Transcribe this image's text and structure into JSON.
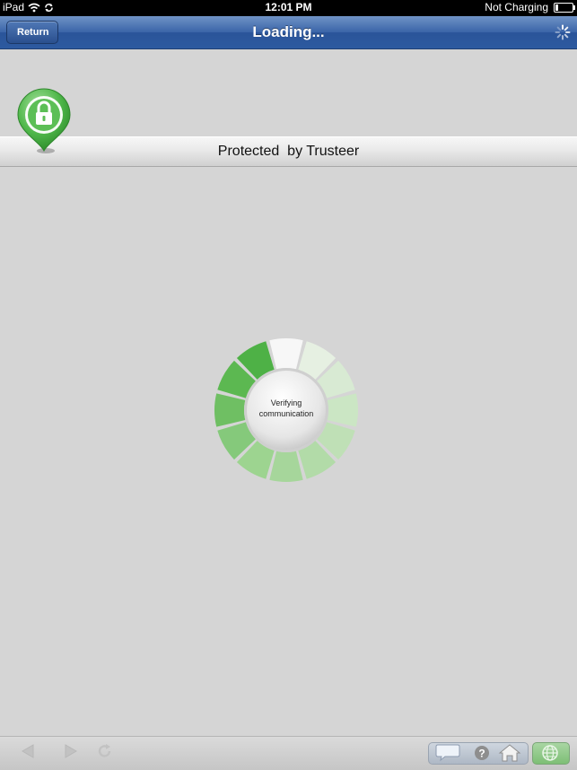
{
  "status_bar": {
    "device": "iPad",
    "time": "12:01 PM",
    "charge_status": "Not Charging"
  },
  "nav": {
    "back_label": "Return",
    "title": "Loading..."
  },
  "banner": {
    "text": "Protected  by Trusteer"
  },
  "progress": {
    "label_line1": "Verifying",
    "label_line2": "communication"
  },
  "colors": {
    "nav_blue": "#2d5aa0",
    "accent_green": "#4db34d",
    "background": "#d5d5d5"
  },
  "toolbar": {
    "icons": [
      "back-arrow-icon",
      "forward-arrow-icon",
      "refresh-icon",
      "chat-icon",
      "help-icon",
      "home-icon",
      "globe-icon"
    ]
  }
}
